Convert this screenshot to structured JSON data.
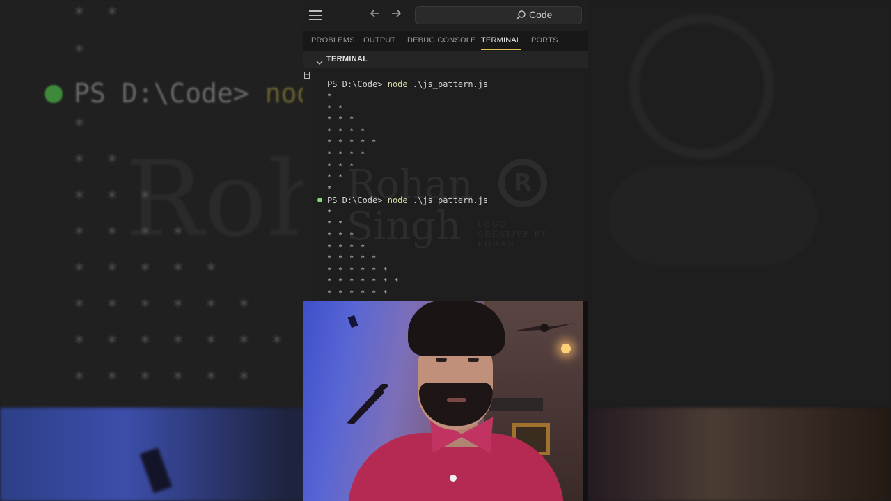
{
  "titlebar": {
    "menu_icon": "hamburger-icon",
    "back_icon": "arrow-left-icon",
    "forward_icon": "arrow-right-icon",
    "search_icon": "search-icon",
    "search_label": "Code"
  },
  "panel_tabs": [
    {
      "label": "PROBLEMS",
      "active": false
    },
    {
      "label": "OUTPUT",
      "active": false
    },
    {
      "label": "DEBUG CONSOLE",
      "active": false
    },
    {
      "label": "TERMINAL",
      "active": true
    },
    {
      "label": "PORTS",
      "active": false
    }
  ],
  "section": {
    "title": "TERMINAL"
  },
  "terminal": {
    "prompt": "PS D:\\Code>",
    "command_keyword": "node",
    "command_arg": ".\\js_pattern.js",
    "run1": [
      "*",
      "* *",
      "* * *",
      "* * * *",
      "* * * * *",
      "* * * *",
      "* * *",
      "* *",
      "*"
    ],
    "run2": [
      "*",
      "* *",
      "* * *",
      "* * * *",
      "* * * * *",
      "* * * * * *",
      "* * * * * * *",
      "* * * * * *"
    ]
  },
  "background_zoom": {
    "prompt": "PS D:\\Code>",
    "keyword": "node",
    "stars": [
      "* *",
      "*",
      "*",
      "* *",
      "* * *",
      "* * * *",
      "* * * * *",
      "* * * * * *",
      "* * * * * * *",
      "* * * * * *"
    ]
  },
  "watermark": {
    "line1": "Rohan",
    "line2": "Singh",
    "mark": "R",
    "tag1": "LOGO",
    "tag2": "CREATIVE BY",
    "tag3": "ROHAN"
  },
  "colors": {
    "accent_tab": "#e7c45a",
    "command_keyword": "#dcdcaa",
    "success_dot": "#89d185",
    "terminal_bg": "#1e1e1e"
  }
}
